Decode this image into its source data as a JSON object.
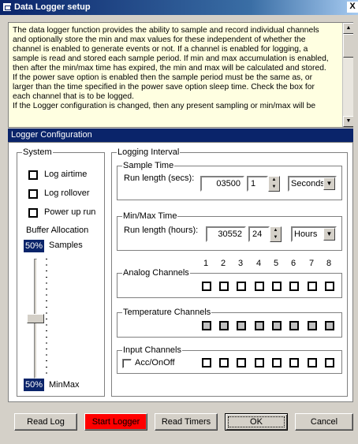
{
  "window": {
    "title": "Data Logger setup",
    "close_label": "X"
  },
  "info_text": "The data logger function provides the ability to sample and record individual channels\nand optionally store the min and max values for these independent of whether the\nchannel is enabled to generate events or not. If a channel is enabled for logging, a\nsample is read and stored each sample period. If min and max accumulation is enabled,\nthen after the min/max time has expired, the min and max will be calculated and stored.\nIf the power save option is enabled then the sample period must be the same as, or\nlarger than the time specified in the power save option sleep time. Check the box for\neach channel that is to be logged.\nIf the Logger configuration is changed, then any present sampling or min/max will be",
  "config_header": "Logger Configuration",
  "system": {
    "legend": "System",
    "log_airtime": "Log airtime",
    "log_rollover": "Log rollover",
    "power_up_run": "Power up run",
    "buffer_label": "Buffer Allocation",
    "samples_pct": "50%",
    "samples_label": "Samples",
    "minmax_pct": "50%",
    "minmax_label": "MinMax",
    "buffer_split_fraction": 0.5
  },
  "logging": {
    "legend": "Logging Interval",
    "sample": {
      "legend": "Sample Time",
      "label": "Run length (secs):",
      "value": "03500",
      "spin_value": "1",
      "unit": "Seconds"
    },
    "minmax": {
      "legend": "Min/Max Time",
      "label": "Run length (hours):",
      "value": "30552",
      "spin_value": "24",
      "unit": "Hours"
    },
    "channel_numbers": [
      "1",
      "2",
      "3",
      "4",
      "5",
      "6",
      "7",
      "8"
    ],
    "analog_legend": "Analog Channels",
    "temperature_legend": "Temperature Channels",
    "input_legend": "Input Channels",
    "acc_label": "Acc/OnOff"
  },
  "buttons": {
    "read_log": "Read Log",
    "start_logger": "Start Logger",
    "read_timers": "Read Timers",
    "ok": "OK",
    "cancel": "Cancel"
  },
  "colors": {
    "title_bar": "#0a246a",
    "start_button": "#ff0000",
    "info_bg": "#ffffe1"
  },
  "icons": {
    "window": "window-icon",
    "close": "close-icon",
    "spin": "spin-arrows-icon",
    "dropdown": "chevron-down-icon"
  }
}
